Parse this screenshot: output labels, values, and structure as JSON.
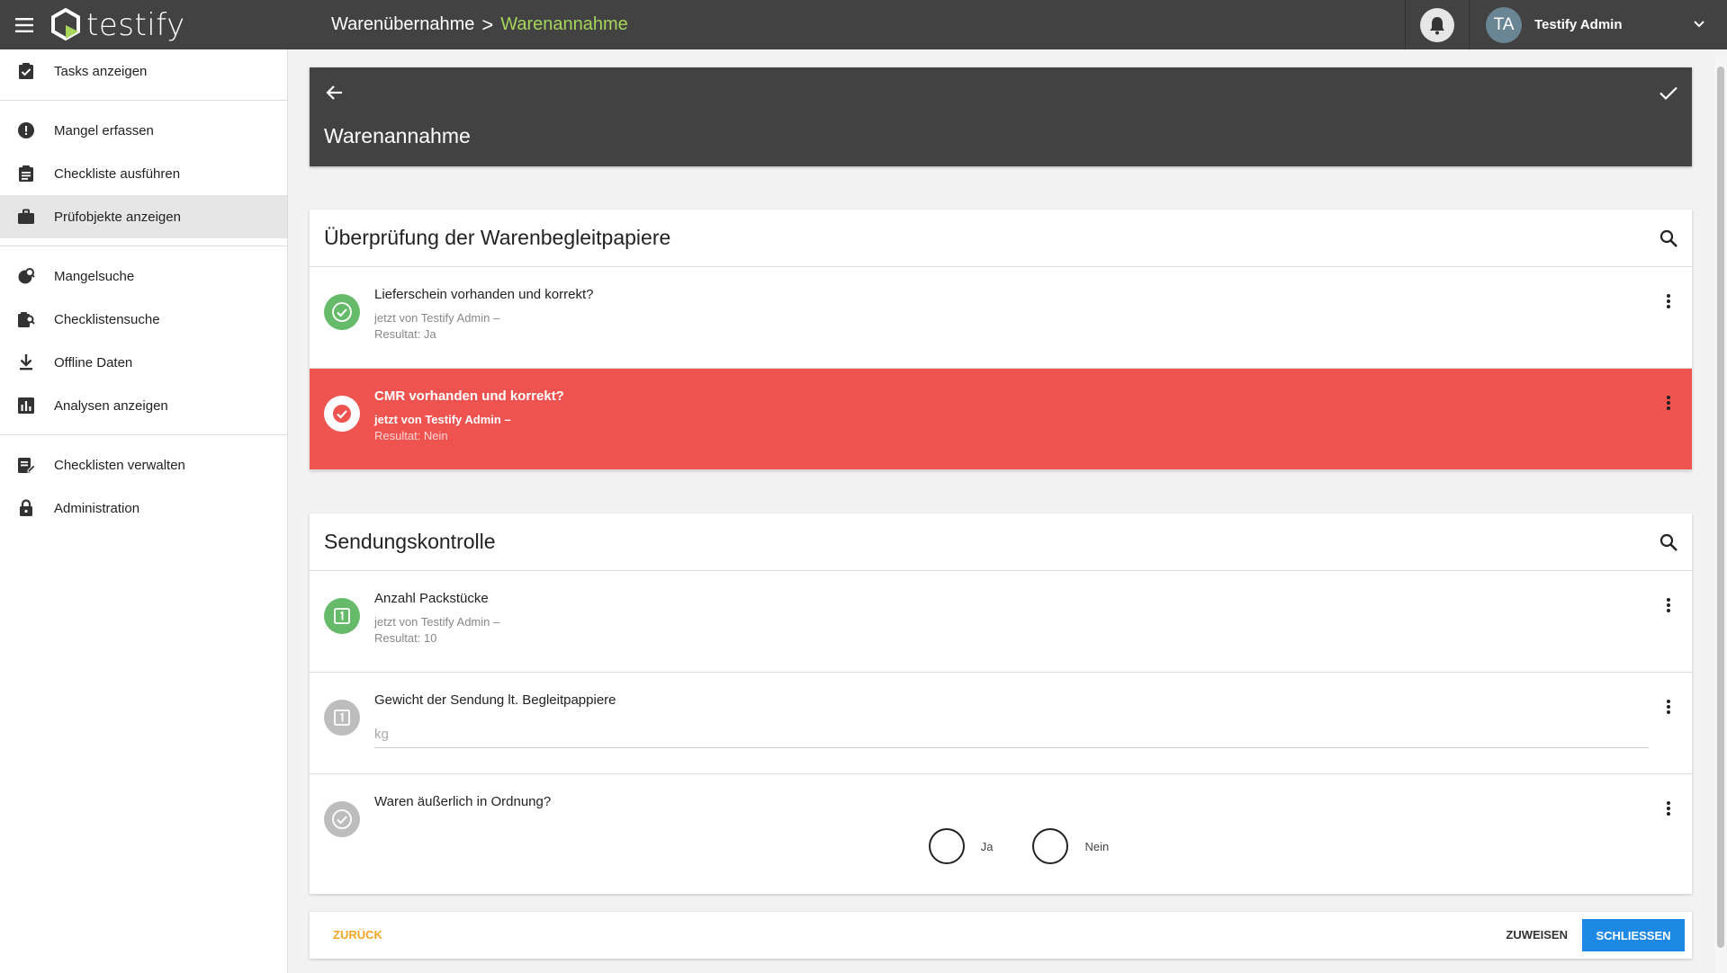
{
  "app": {
    "logo_text": "testify"
  },
  "breadcrumb": {
    "parent": "Warenübernahme",
    "separator": ">",
    "current": "Warenannahme"
  },
  "user": {
    "initials": "TA",
    "name": "Testify Admin"
  },
  "sidebar": {
    "groups": [
      [
        {
          "label": "Tasks anzeigen",
          "icon": "clipboard-check-icon"
        }
      ],
      [
        {
          "label": "Mangel erfassen",
          "icon": "alert-circle-icon"
        },
        {
          "label": "Checkliste ausführen",
          "icon": "clipboard-list-icon"
        },
        {
          "label": "Prüfobjekte anzeigen",
          "icon": "briefcase-icon",
          "active": true
        }
      ],
      [
        {
          "label": "Mangelsuche",
          "icon": "search-defect-icon"
        },
        {
          "label": "Checklistensuche",
          "icon": "search-checklist-icon"
        },
        {
          "label": "Offline Daten",
          "icon": "download-icon"
        },
        {
          "label": "Analysen anzeigen",
          "icon": "chart-icon"
        }
      ],
      [
        {
          "label": "Checklisten verwalten",
          "icon": "edit-document-icon"
        },
        {
          "label": "Administration",
          "icon": "lock-icon"
        }
      ]
    ]
  },
  "header": {
    "title": "Warenannahme"
  },
  "sections": [
    {
      "title": "Überprüfung der Warenbegleitpapiere",
      "items": [
        {
          "title": "Lieferschein vorhanden und korrekt?",
          "meta": "jetzt von Testify Admin –",
          "result": "Resultat: Ja",
          "status": "ok"
        },
        {
          "title": "CMR vorhanden und korrekt?",
          "meta": "jetzt von Testify Admin –",
          "result": "Resultat: Nein",
          "status": "fail"
        }
      ]
    },
    {
      "title": "Sendungskontrolle",
      "items": [
        {
          "title": "Anzahl Packstücke",
          "meta": "jetzt von Testify Admin –",
          "result": "Resultat: 10",
          "status": "number-done"
        },
        {
          "title": "Gewicht der Sendung lt. Begleitpappiere",
          "placeholder": "kg",
          "status": "number-open"
        },
        {
          "title": "Waren äußerlich in Ordnung?",
          "options": [
            "Ja",
            "Nein"
          ],
          "status": "choice-open"
        }
      ]
    }
  ],
  "footer": {
    "back_label": "ZURÜCK",
    "assign_label": "ZUWEISEN",
    "close_label": "SCHLIESSEN"
  },
  "colors": {
    "topbar": "#424242",
    "accent_green": "#a5d65a",
    "ok_green": "#66bb6a",
    "fail_red": "#ef5350",
    "primary_blue": "#1e88e5",
    "back_orange": "#f5a623"
  }
}
